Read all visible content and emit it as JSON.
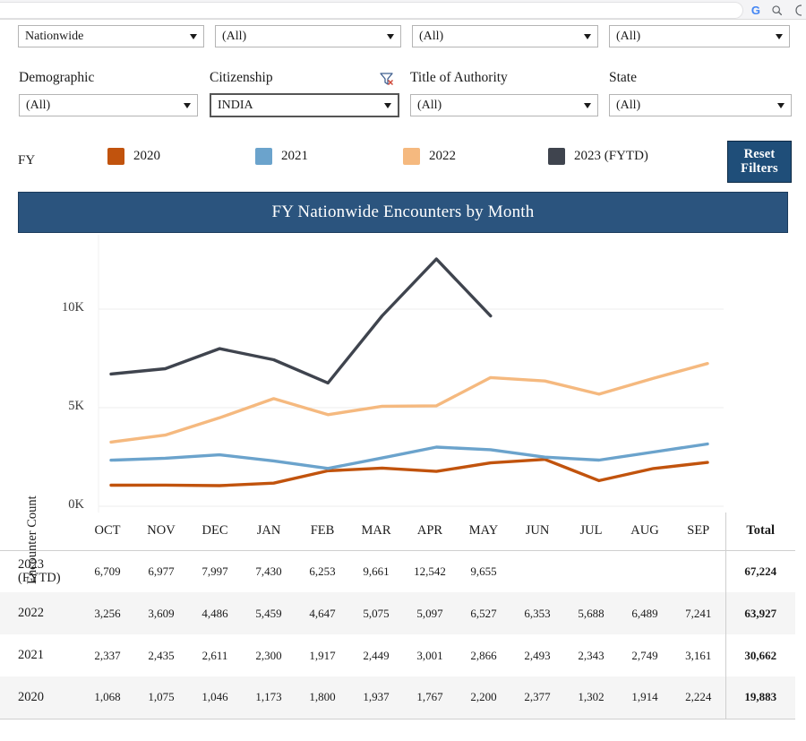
{
  "browser": {
    "icons": [
      "google-g-icon",
      "search-icon",
      "partial-icon"
    ],
    "google_letter": "G"
  },
  "filters": {
    "top_row": [
      {
        "name": "region",
        "value": "Nationwide",
        "label": ""
      },
      {
        "name": "filter-2",
        "value": "(All)",
        "label": ""
      },
      {
        "name": "filter-3",
        "value": "(All)",
        "label": ""
      },
      {
        "name": "filter-4",
        "value": "(All)",
        "label": ""
      }
    ],
    "second_row": [
      {
        "name": "demographic",
        "label": "Demographic",
        "value": "(All)"
      },
      {
        "name": "citizenship",
        "label": "Citizenship",
        "value": "INDIA"
      },
      {
        "name": "title-of-authority",
        "label": "Title of Authority",
        "value": "(All)"
      },
      {
        "name": "state",
        "label": "State",
        "value": "(All)"
      }
    ],
    "clear_filter_icon": "clear-filter-icon"
  },
  "legend": {
    "title": "FY",
    "items": [
      {
        "label": "2020",
        "color": "#C1530D"
      },
      {
        "label": "2021",
        "color": "#6BA3CC"
      },
      {
        "label": "2022",
        "color": "#F5B97F"
      },
      {
        "label": "2023 (FYTD)",
        "color": "#3F444E"
      }
    ]
  },
  "reset_button": {
    "line1": "Reset",
    "line2": "Filters"
  },
  "chart_data": {
    "type": "line",
    "title": "FY Nationwide Encounters by Month",
    "xlabel": "",
    "ylabel": "Encounter Count",
    "ylim": [
      0,
      13500
    ],
    "yticks": [
      "0K",
      "5K",
      "10K"
    ],
    "ytick_values": [
      0,
      5000,
      10000
    ],
    "grid": true,
    "legend_position": "top",
    "categories": [
      "OCT",
      "NOV",
      "DEC",
      "JAN",
      "FEB",
      "MAR",
      "APR",
      "MAY",
      "JUN",
      "JUL",
      "AUG",
      "SEP"
    ],
    "series": [
      {
        "name": "2020",
        "color": "#C1530D",
        "values": [
          1068,
          1075,
          1046,
          1173,
          1800,
          1937,
          1767,
          2200,
          2377,
          1302,
          1914,
          2224
        ]
      },
      {
        "name": "2021",
        "color": "#6BA3CC",
        "values": [
          2337,
          2435,
          2611,
          2300,
          1917,
          2449,
          3001,
          2866,
          2493,
          2343,
          2749,
          3161
        ]
      },
      {
        "name": "2022",
        "color": "#F5B97F",
        "values": [
          3256,
          3609,
          4486,
          5459,
          4647,
          5075,
          5097,
          6527,
          6353,
          5688,
          6489,
          7241
        ]
      },
      {
        "name": "2023 (FYTD)",
        "color": "#3F444E",
        "values": [
          6709,
          6977,
          7997,
          7430,
          6253,
          9661,
          12542,
          9655,
          null,
          null,
          null,
          null
        ]
      }
    ]
  },
  "table": {
    "columns": [
      "",
      "OCT",
      "NOV",
      "DEC",
      "JAN",
      "FEB",
      "MAR",
      "APR",
      "MAY",
      "JUN",
      "JUL",
      "AUG",
      "SEP",
      "Total"
    ],
    "rows": [
      {
        "label": "2023 (FYTD)",
        "cells": [
          "6,709",
          "6,977",
          "7,997",
          "7,430",
          "6,253",
          "9,661",
          "12,542",
          "9,655",
          "",
          "",
          "",
          ""
        ],
        "total": "67,224"
      },
      {
        "label": "2022",
        "cells": [
          "3,256",
          "3,609",
          "4,486",
          "5,459",
          "4,647",
          "5,075",
          "5,097",
          "6,527",
          "6,353",
          "5,688",
          "6,489",
          "7,241"
        ],
        "total": "63,927"
      },
      {
        "label": "2021",
        "cells": [
          "2,337",
          "2,435",
          "2,611",
          "2,300",
          "1,917",
          "2,449",
          "3,001",
          "2,866",
          "2,493",
          "2,343",
          "2,749",
          "3,161"
        ],
        "total": "30,662"
      },
      {
        "label": "2020",
        "cells": [
          "1,068",
          "1,075",
          "1,046",
          "1,173",
          "1,800",
          "1,937",
          "1,767",
          "2,200",
          "2,377",
          "1,302",
          "1,914",
          "2,224"
        ],
        "total": "19,883"
      }
    ]
  },
  "colors": {
    "banner": "#2B547E",
    "reset_button": "#1F4E79",
    "grid": "#ececec"
  }
}
